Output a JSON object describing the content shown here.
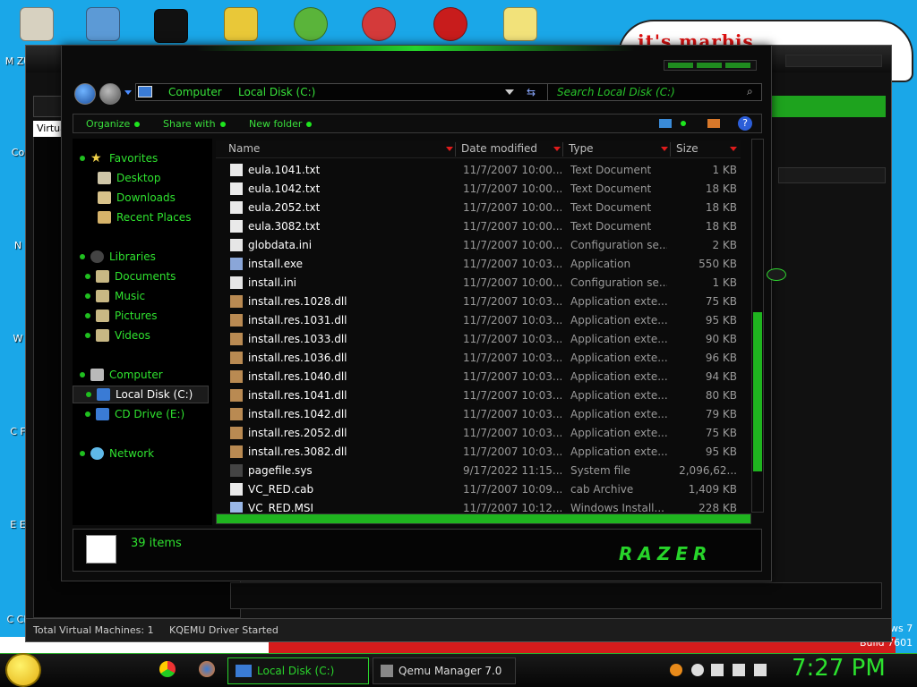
{
  "desktop": {
    "banner_text": "it's marbis",
    "build_text": "Build 7601",
    "build_win_text": "ws 7",
    "icons": [
      {
        "name": "my-computer",
        "label": "M ZU"
      },
      {
        "name": "computer",
        "label": "Co"
      },
      {
        "name": "network",
        "label": "N"
      },
      {
        "name": "w",
        "label": "W"
      },
      {
        "name": "c",
        "label": "C F"
      },
      {
        "name": "e",
        "label": "E E"
      },
      {
        "name": "cl",
        "label": "C CL"
      }
    ]
  },
  "qemu_window": {
    "tab_label": "Virtua",
    "status": {
      "machines": "Total Virtual Machines: 1",
      "driver": "KQEMU Driver Started"
    }
  },
  "explorer": {
    "address": {
      "crumb1": "Computer",
      "crumb2": "Local Disk (C:)"
    },
    "search_placeholder": "Search Local Disk (C:)",
    "commands": {
      "organize": "Organize",
      "share": "Share with",
      "new_folder": "New folder"
    },
    "nav": {
      "favorites": "Favorites",
      "desktop": "Desktop",
      "downloads": "Downloads",
      "recent": "Recent Places",
      "libraries": "Libraries",
      "documents": "Documents",
      "music": "Music",
      "pictures": "Pictures",
      "videos": "Videos",
      "computer": "Computer",
      "local_disk": "Local Disk (C:)",
      "cd_drive": "CD Drive (E:)",
      "network": "Network"
    },
    "columns": {
      "name": "Name",
      "date": "Date modified",
      "type": "Type",
      "size": "Size"
    },
    "files": [
      {
        "name": "eula.1041.txt",
        "date": "11/7/2007 10:00...",
        "type": "Text Document",
        "size": "1 KB",
        "icon": "text"
      },
      {
        "name": "eula.1042.txt",
        "date": "11/7/2007 10:00...",
        "type": "Text Document",
        "size": "18 KB",
        "icon": "text"
      },
      {
        "name": "eula.2052.txt",
        "date": "11/7/2007 10:00...",
        "type": "Text Document",
        "size": "18 KB",
        "icon": "text"
      },
      {
        "name": "eula.3082.txt",
        "date": "11/7/2007 10:00...",
        "type": "Text Document",
        "size": "18 KB",
        "icon": "text"
      },
      {
        "name": "globdata.ini",
        "date": "11/7/2007 10:00...",
        "type": "Configuration se...",
        "size": "2 KB",
        "icon": "ini"
      },
      {
        "name": "install.exe",
        "date": "11/7/2007 10:03...",
        "type": "Application",
        "size": "550 KB",
        "icon": "exe"
      },
      {
        "name": "install.ini",
        "date": "11/7/2007 10:00...",
        "type": "Configuration se...",
        "size": "1 KB",
        "icon": "ini"
      },
      {
        "name": "install.res.1028.dll",
        "date": "11/7/2007 10:03...",
        "type": "Application exte...",
        "size": "75 KB",
        "icon": "dll"
      },
      {
        "name": "install.res.1031.dll",
        "date": "11/7/2007 10:03...",
        "type": "Application exte...",
        "size": "95 KB",
        "icon": "dll"
      },
      {
        "name": "install.res.1033.dll",
        "date": "11/7/2007 10:03...",
        "type": "Application exte...",
        "size": "90 KB",
        "icon": "dll"
      },
      {
        "name": "install.res.1036.dll",
        "date": "11/7/2007 10:03...",
        "type": "Application exte...",
        "size": "96 KB",
        "icon": "dll"
      },
      {
        "name": "install.res.1040.dll",
        "date": "11/7/2007 10:03...",
        "type": "Application exte...",
        "size": "94 KB",
        "icon": "dll"
      },
      {
        "name": "install.res.1041.dll",
        "date": "11/7/2007 10:03...",
        "type": "Application exte...",
        "size": "80 KB",
        "icon": "dll"
      },
      {
        "name": "install.res.1042.dll",
        "date": "11/7/2007 10:03...",
        "type": "Application exte...",
        "size": "79 KB",
        "icon": "dll"
      },
      {
        "name": "install.res.2052.dll",
        "date": "11/7/2007 10:03...",
        "type": "Application exte...",
        "size": "75 KB",
        "icon": "dll"
      },
      {
        "name": "install.res.3082.dll",
        "date": "11/7/2007 10:03...",
        "type": "Application exte...",
        "size": "95 KB",
        "icon": "dll"
      },
      {
        "name": "pagefile.sys",
        "date": "9/17/2022 11:15...",
        "type": "System file",
        "size": "2,096,62...",
        "icon": "sys"
      },
      {
        "name": "VC_RED.cab",
        "date": "11/7/2007 10:09...",
        "type": "cab Archive",
        "size": "1,409 KB",
        "icon": "cab"
      },
      {
        "name": "VC_RED.MSI",
        "date": "11/7/2007 10:12...",
        "type": "Windows Install...",
        "size": "228 KB",
        "icon": "msi"
      }
    ],
    "item_count": "39 items",
    "brand": "RAZER"
  },
  "taskbar": {
    "items": [
      {
        "label": "Local Disk (C:)",
        "active": true
      },
      {
        "label": "Qemu Manager 7.0",
        "active": false
      }
    ],
    "clock": "7:27 PM"
  },
  "colors": {
    "accent": "#2ad42c",
    "background": "#0b0b0b",
    "desktop": "#1aa7e8"
  }
}
